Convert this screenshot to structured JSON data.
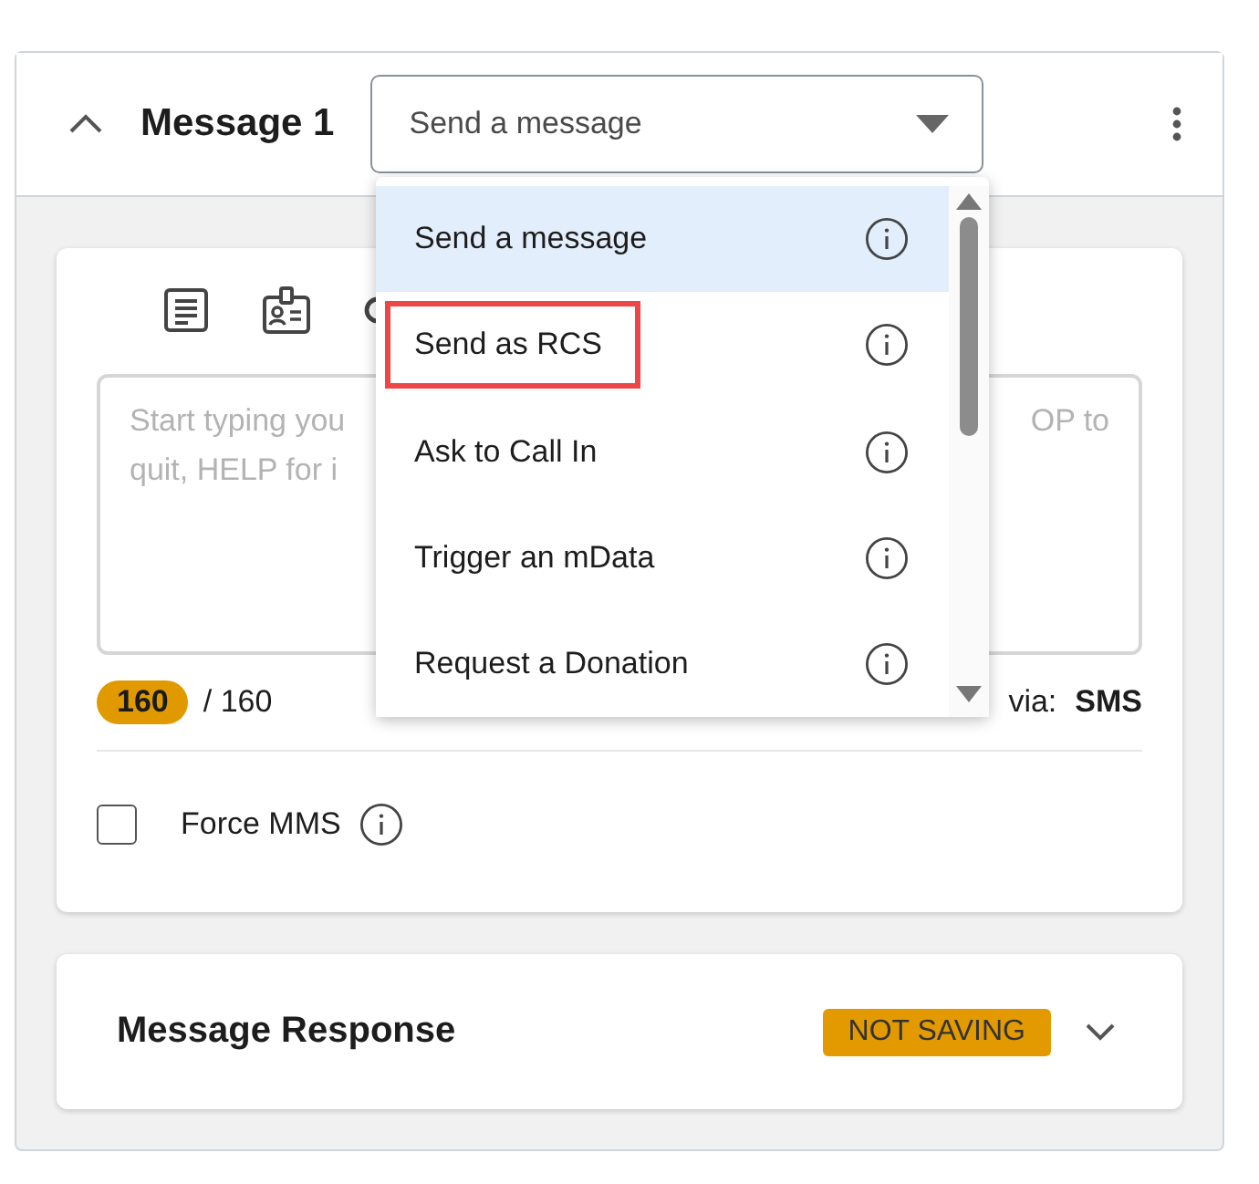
{
  "header": {
    "expanded": true,
    "title": "Message 1",
    "select_value": "Send a message"
  },
  "menu": {
    "items": [
      {
        "label": "Send a message",
        "selected": true,
        "highlighted": false
      },
      {
        "label": "Send as RCS",
        "selected": false,
        "highlighted": true
      },
      {
        "label": "Ask to Call In",
        "selected": false,
        "highlighted": false
      },
      {
        "label": "Trigger an mData",
        "selected": false,
        "highlighted": false
      },
      {
        "label": "Request a Donation",
        "selected": false,
        "highlighted": false
      }
    ]
  },
  "editor": {
    "placeholder_left": [
      "Start typing you",
      "quit, HELP for i"
    ],
    "placeholder_right": [
      "OP to"
    ],
    "count": "160",
    "limit": "/ 160",
    "via_label": "via:",
    "via_value": "SMS",
    "force_mms": {
      "label": "Force MMS",
      "checked": false
    }
  },
  "response": {
    "title": "Message Response",
    "status": "NOT SAVING",
    "expanded": false
  }
}
